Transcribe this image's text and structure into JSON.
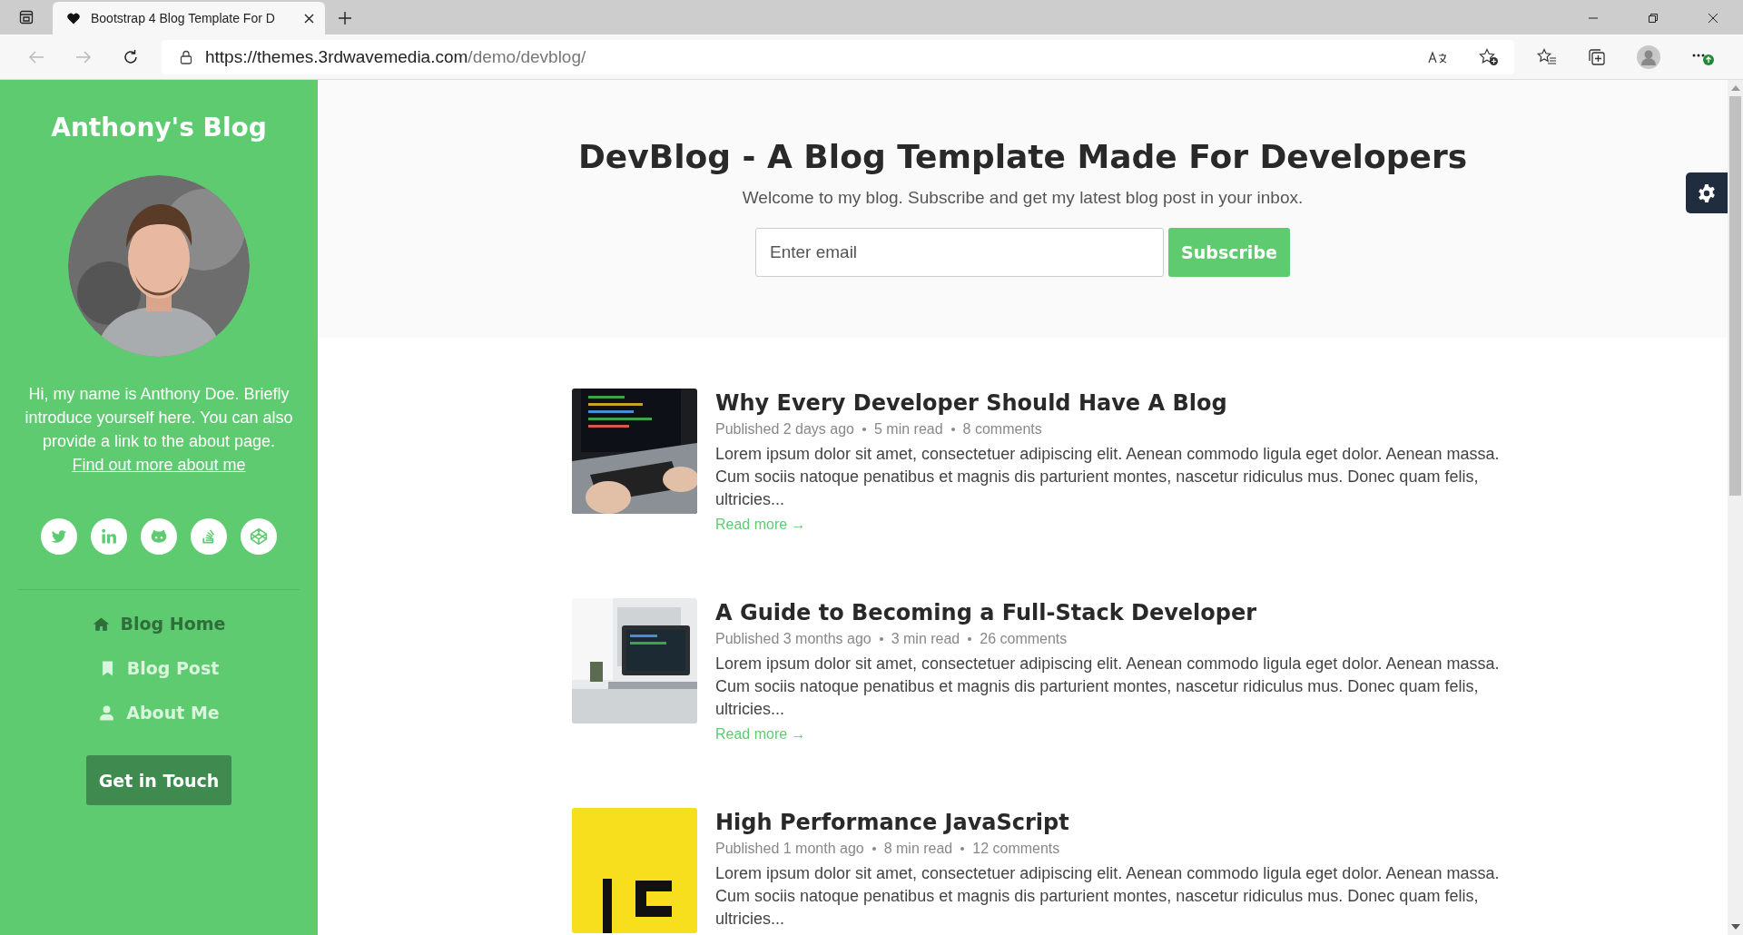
{
  "browser": {
    "tab_title": "Bootstrap 4 Blog Template For D",
    "url_host": "https://themes.3rdwavemedia.com",
    "url_path": "/demo/devblog/"
  },
  "sidebar": {
    "title": "Anthony's Blog",
    "bio": "Hi, my name is Anthony Doe. Briefly introduce yourself here. You can also provide a link to the about page.",
    "about_link": "Find out more about me",
    "social": [
      {
        "kind": "twitter"
      },
      {
        "kind": "linkedin"
      },
      {
        "kind": "github"
      },
      {
        "kind": "stackoverflow"
      },
      {
        "kind": "codepen"
      }
    ],
    "nav": [
      {
        "label": "Blog Home",
        "kind": "home",
        "selected": true
      },
      {
        "label": "Blog Post",
        "kind": "bookmark",
        "selected": false
      },
      {
        "label": "About Me",
        "kind": "user",
        "selected": false
      }
    ],
    "button": "Get in Touch"
  },
  "header": {
    "title": "DevBlog - A Blog Template Made For Developers",
    "subtitle": "Welcome to my blog. Subscribe and get my latest blog post in your inbox.",
    "email_placeholder": "Enter email",
    "subscribe": "Subscribe"
  },
  "posts": [
    {
      "kind": "laptop",
      "title": "Why Every Developer Should Have A Blog",
      "meta": [
        "Published 2 days ago",
        "5 min read",
        "8 comments"
      ],
      "excerpt": "Lorem ipsum dolor sit amet, consectetuer adipiscing elit. Aenean commodo ligula eget dolor. Aenean massa. Cum sociis natoque penatibus et magnis dis parturient montes, nascetur ridiculus mus. Donec quam felis, ultricies...",
      "read_more": "Read more →"
    },
    {
      "kind": "desk",
      "title": "A Guide to Becoming a Full-Stack Developer",
      "meta": [
        "Published 3 months ago",
        "3 min read",
        "26 comments"
      ],
      "excerpt": "Lorem ipsum dolor sit amet, consectetuer adipiscing elit. Aenean commodo ligula eget dolor. Aenean massa. Cum sociis natoque penatibus et magnis dis parturient montes, nascetur ridiculus mus. Donec quam felis, ultricies...",
      "read_more": "Read more →"
    },
    {
      "kind": "yellow",
      "title": "High Performance JavaScript",
      "meta": [
        "Published 1 month ago",
        "8 min read",
        "12 comments"
      ],
      "excerpt": "Lorem ipsum dolor sit amet, consectetuer adipiscing elit. Aenean commodo ligula eget dolor. Aenean massa. Cum sociis natoque penatibus et magnis dis parturient montes, nascetur ridiculus mus. Donec quam felis, ultricies..."
    }
  ]
}
